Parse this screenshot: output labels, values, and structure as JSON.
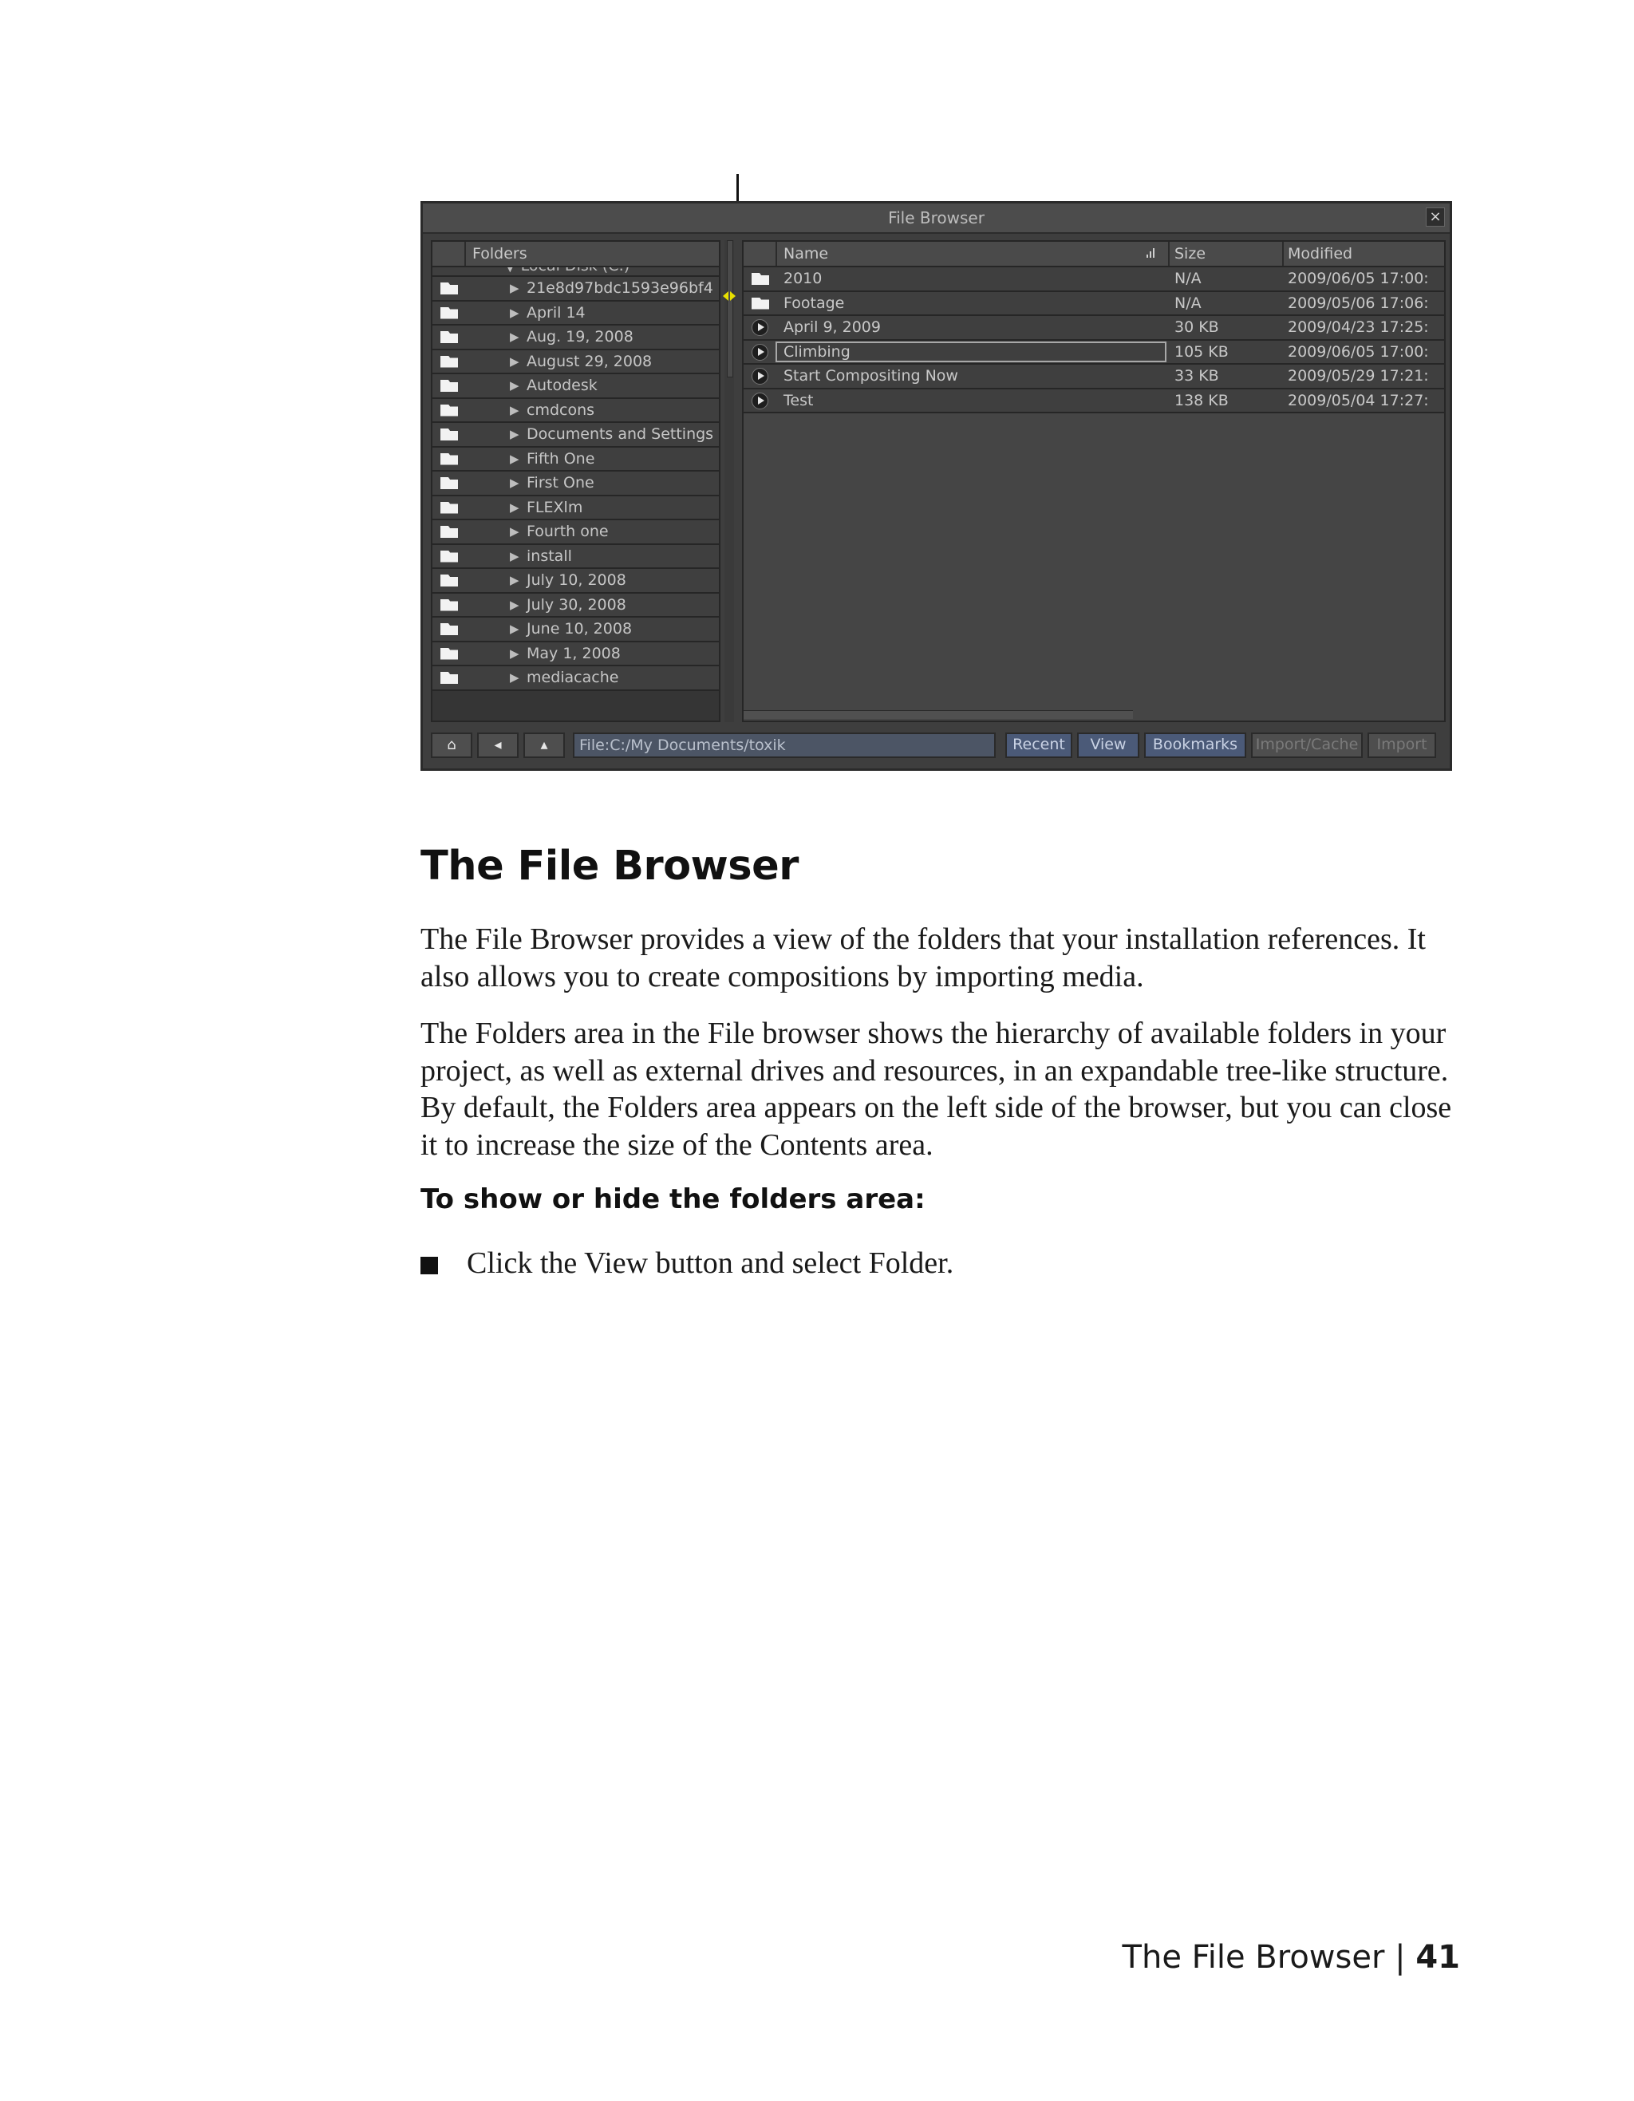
{
  "file_browser": {
    "title": "File Browser",
    "close_glyph": "×",
    "folders": {
      "header": "Folders",
      "partial_top": "▼ Local Disk (C:)",
      "items": [
        "21e8d97bdc1593e96bf4",
        "April 14",
        "Aug. 19, 2008",
        "August 29, 2008",
        "Autodesk",
        "cmdcons",
        "Documents and Settings",
        "Fifth One",
        "First One",
        "FLEXlm",
        "Fourth one",
        "install",
        "July 10, 2008",
        "July 30, 2008",
        "June 10, 2008",
        "May 1, 2008",
        "mediacache"
      ]
    },
    "contents": {
      "columns": {
        "name": "Name",
        "size": "Size",
        "modified": "Modified"
      },
      "rows": [
        {
          "type": "folder",
          "name": "2010",
          "size": "N/A",
          "modified": "2009/06/05 17:00:"
        },
        {
          "type": "folder",
          "name": "Footage",
          "size": "N/A",
          "modified": "2009/05/06 17:06:"
        },
        {
          "type": "clip",
          "name": "April 9, 2009",
          "size": "30 KB",
          "modified": "2009/04/23 17:25:"
        },
        {
          "type": "clip",
          "name": "Climbing",
          "size": "105 KB",
          "modified": "2009/06/05 17:00:",
          "selected": true
        },
        {
          "type": "clip",
          "name": "Start Compositing Now",
          "size": "33 KB",
          "modified": "2009/05/29 17:21:"
        },
        {
          "type": "clip",
          "name": "Test",
          "size": "138 KB",
          "modified": "2009/05/04 17:27:"
        }
      ]
    },
    "toolbar": {
      "home_glyph": "⌂",
      "back_glyph": "◂",
      "up_glyph": "▴",
      "path": "File:C:/My Documents/toxik",
      "recent": "Recent",
      "view": "View",
      "bookmarks": "Bookmarks",
      "import_cache": "Import/Cache",
      "import": "Import"
    }
  },
  "section": {
    "heading": "The File Browser",
    "para1": "The File Browser provides a view of the folders that your installation references. It also allows you to create compositions by importing media.",
    "para2": "The Folders area in the File browser shows the hierarchy of available folders in your project, as well as external drives and resources, in an expandable tree-like structure. By default, the Folders area appears on the left side of the browser, but you can close it to increase the size of the Contents area.",
    "procedure_title": "To show or hide the folders area:",
    "step1": "Click the View button and select Folder."
  },
  "footer": {
    "section": "The File Browser",
    "separator": "|",
    "page": "41"
  }
}
